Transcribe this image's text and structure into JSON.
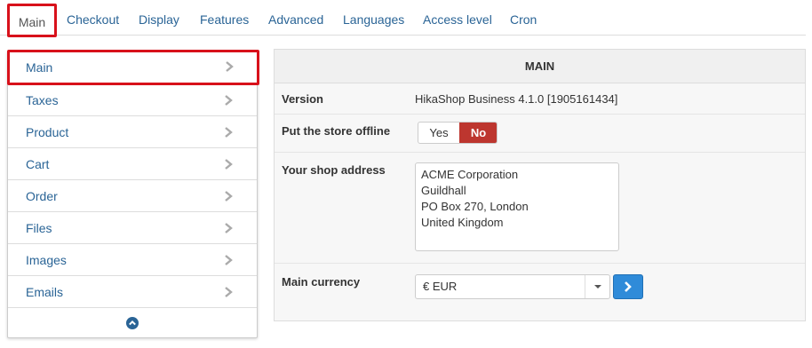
{
  "tabs": [
    {
      "label": "Main",
      "active": true
    },
    {
      "label": "Checkout"
    },
    {
      "label": "Display"
    },
    {
      "label": "Features"
    },
    {
      "label": "Advanced"
    },
    {
      "label": "Languages"
    },
    {
      "label": "Access level"
    },
    {
      "label": "Cron"
    }
  ],
  "sidebar": {
    "items": [
      {
        "label": "Main",
        "active": true
      },
      {
        "label": "Taxes"
      },
      {
        "label": "Product"
      },
      {
        "label": "Cart"
      },
      {
        "label": "Order"
      },
      {
        "label": "Files"
      },
      {
        "label": "Images"
      },
      {
        "label": "Emails"
      }
    ],
    "collapse_icon": "chevron-up-circle-icon"
  },
  "panel": {
    "title": "MAIN",
    "version_label": "Version",
    "version_value": "HikaShop Business 4.1.0 [1905161434]",
    "offline_label": "Put the store offline",
    "offline_yes": "Yes",
    "offline_no": "No",
    "offline_selected": "No",
    "address_label": "Your shop address",
    "address_value": "ACME Corporation\nGuildhall\nPO Box 270, London\nUnited Kingdom",
    "currency_label": "Main currency",
    "currency_value": "€ EUR"
  },
  "colors": {
    "link": "#2a6496",
    "highlight_border": "#d8111b",
    "no_active": "#bd362f",
    "go_button": "#2f8bd9"
  }
}
